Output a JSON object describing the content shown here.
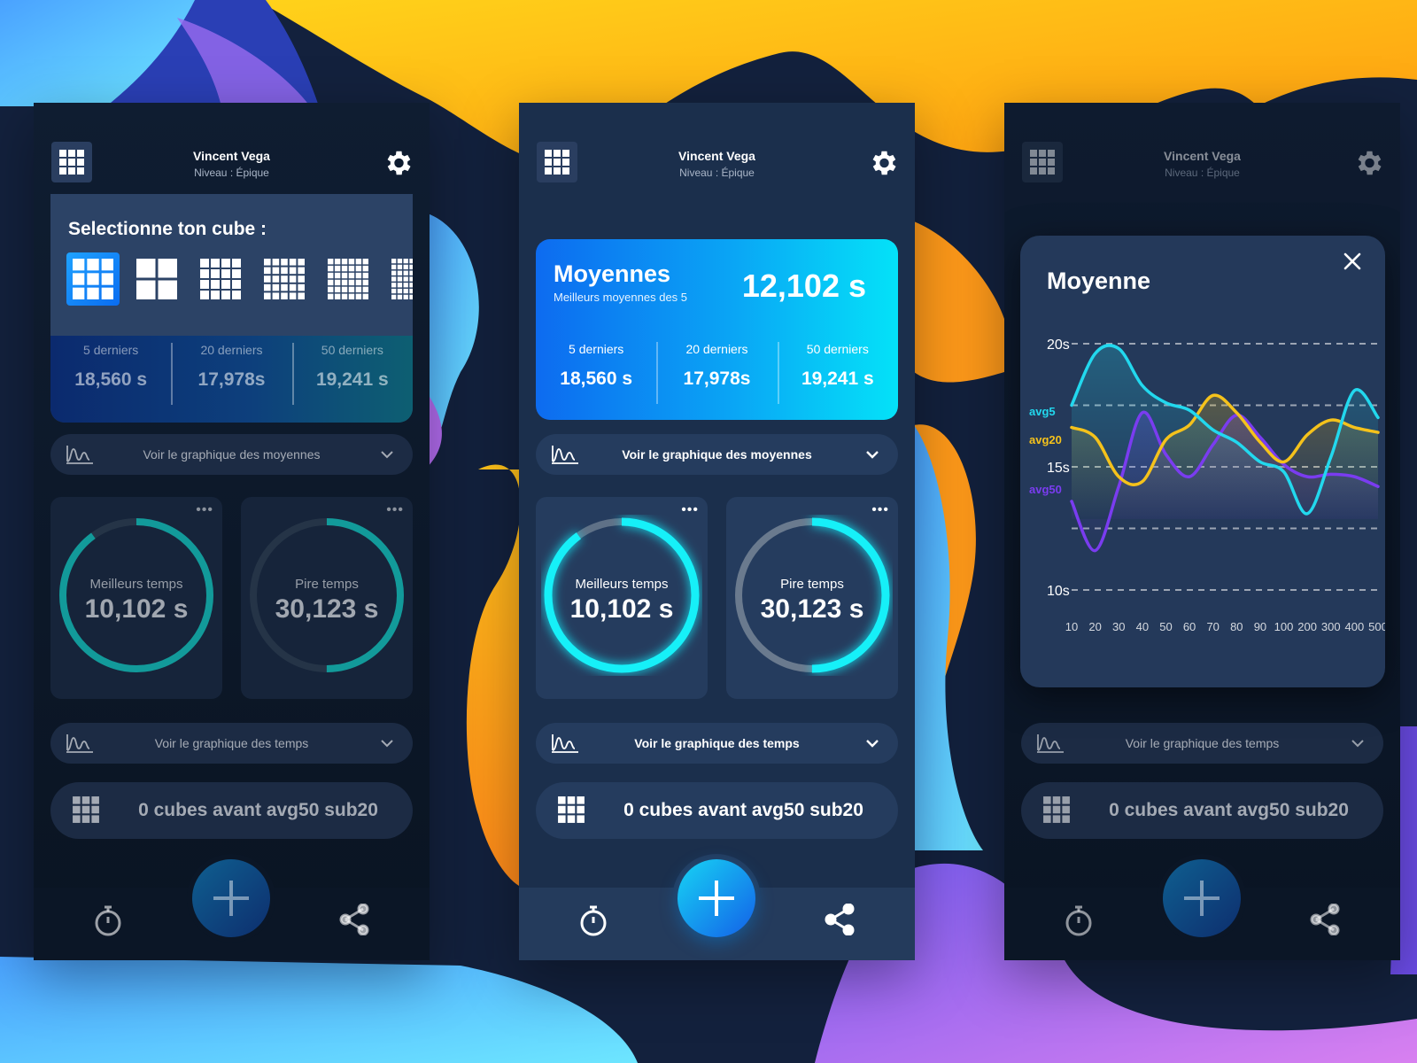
{
  "header": {
    "name": "Vincent Vega",
    "level": "Niveau : Épique"
  },
  "cube_select": {
    "title": "Selectionne ton cube :",
    "selected_index": 0,
    "option_sizes": [
      3,
      2,
      4,
      5,
      6,
      7
    ]
  },
  "stats": [
    {
      "label": "5 derniers",
      "value": "18,560 s"
    },
    {
      "label": "20 derniers",
      "value": "17,978s"
    },
    {
      "label": "50 derniers",
      "value": "19,241 s"
    }
  ],
  "moyennes": {
    "title": "Moyennes",
    "subtitle": "Meilleurs moyennes des 5",
    "value": "12,102 s"
  },
  "pill_averages": "Voir le graphique des moyennes",
  "pill_times": "Voir le graphique des temps",
  "best": {
    "label": "Meilleurs temps",
    "value": "10,102 s",
    "progress": 0.9
  },
  "worst": {
    "label": "Pire temps",
    "value": "30,123 s",
    "progress": 0.5
  },
  "more_dots": "•••",
  "sub20_text": "0 cubes avant avg50 sub20",
  "modal": {
    "title": "Moyenne",
    "close_icon": "close-icon"
  },
  "colors": {
    "avg5": "#22d8ee",
    "avg20": "#f5c21b",
    "avg50": "#7a3cf0",
    "accent": "#0aa6f5"
  },
  "chart_data": {
    "type": "line",
    "title": "Moyenne",
    "xlabel": "",
    "ylabel": "",
    "x": [
      "10",
      "20",
      "30",
      "40",
      "50",
      "60",
      "70",
      "80",
      "90",
      "100",
      "200",
      "300",
      "400",
      "500"
    ],
    "y_ticks": [
      "20s",
      "15s",
      "10s"
    ],
    "ylim": [
      10,
      20
    ],
    "grid": true,
    "legend": "left",
    "series": [
      {
        "name": "avg5",
        "values": [
          17.5,
          19.6,
          19.8,
          18.3,
          17.6,
          17.3,
          16.5,
          16.0,
          15.2,
          14.8,
          13.1,
          15.4,
          18.1,
          17.0
        ]
      },
      {
        "name": "avg20",
        "values": [
          16.6,
          16.2,
          14.6,
          14.4,
          16.1,
          16.7,
          17.9,
          17.2,
          16.0,
          15.2,
          16.3,
          16.9,
          16.6,
          16.4
        ]
      },
      {
        "name": "avg50",
        "values": [
          13.6,
          11.6,
          14.2,
          17.2,
          15.5,
          14.6,
          15.9,
          17.1,
          16.2,
          15.1,
          14.6,
          14.7,
          14.6,
          14.2
        ]
      }
    ]
  }
}
